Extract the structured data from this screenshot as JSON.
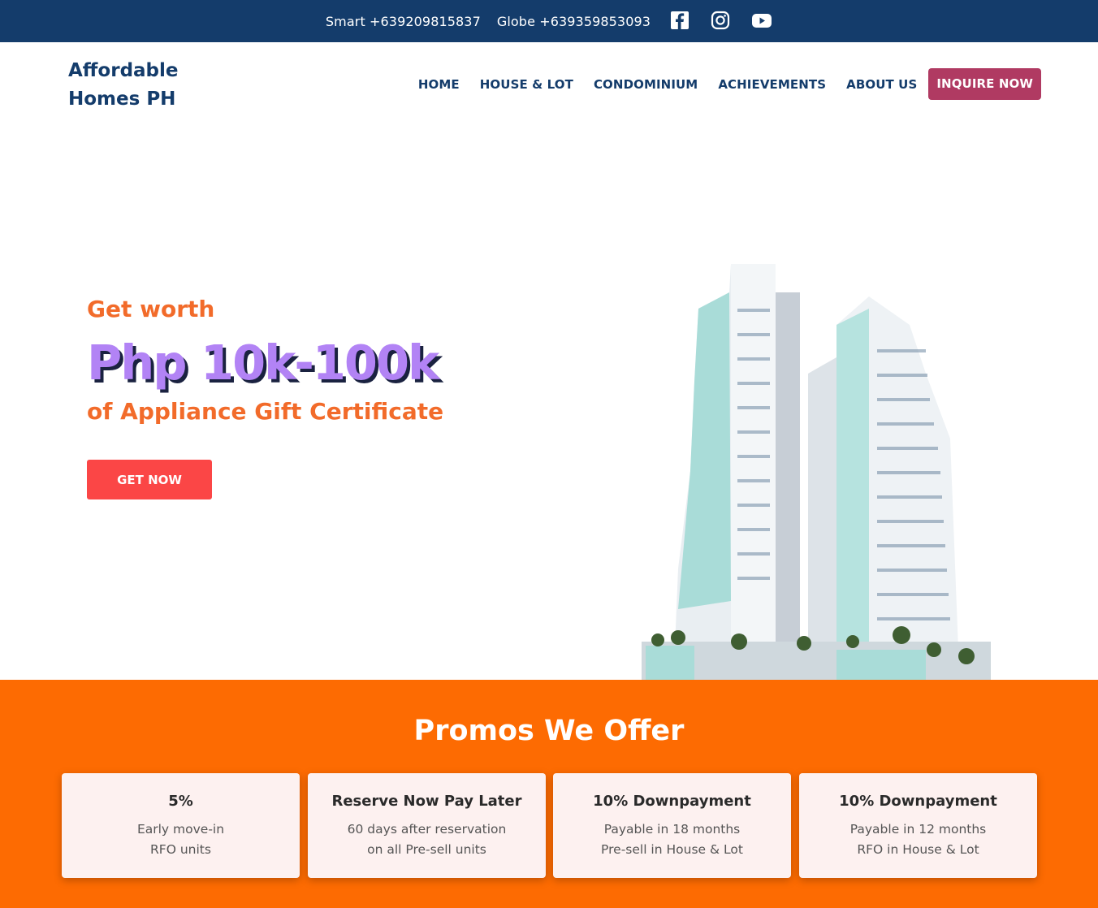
{
  "topbar": {
    "smart": "Smart +639209815837",
    "globe": "Globe +639359853093",
    "icons": [
      "facebook-icon",
      "instagram-icon",
      "youtube-icon"
    ]
  },
  "brand": {
    "line1": "Affordable",
    "line2": "Homes PH"
  },
  "nav": {
    "items": [
      "HOME",
      "HOUSE & LOT",
      "CONDOMINIUM",
      "ACHIEVEMENTS",
      "ABOUT US"
    ],
    "cta": "INQUIRE NOW"
  },
  "hero": {
    "kicker": "Get worth",
    "amount": "Php 10k-100k",
    "sub": "of Appliance Gift Certificate",
    "button": "GET NOW"
  },
  "promos": {
    "title": "Promos We Offer",
    "cards": [
      {
        "title": "5%",
        "line1": "Early move-in",
        "line2": "RFO units"
      },
      {
        "title": "Reserve Now Pay Later",
        "line1": "60 days after reservation",
        "line2": "on all Pre-sell units"
      },
      {
        "title": "10% Downpayment",
        "line1": "Payable in 18 months",
        "line2": "Pre-sell in House & Lot"
      },
      {
        "title": "10% Downpayment",
        "line1": "Payable in 12 months",
        "line2": "RFO in House & Lot"
      }
    ]
  },
  "colors": {
    "topbar": "#143c6b",
    "inquire": "#b03a62",
    "accent_orange": "#f26b2a",
    "amount_purple": "#b283f5",
    "get_button": "#fb4646",
    "promo_band": "#fd6b02"
  }
}
